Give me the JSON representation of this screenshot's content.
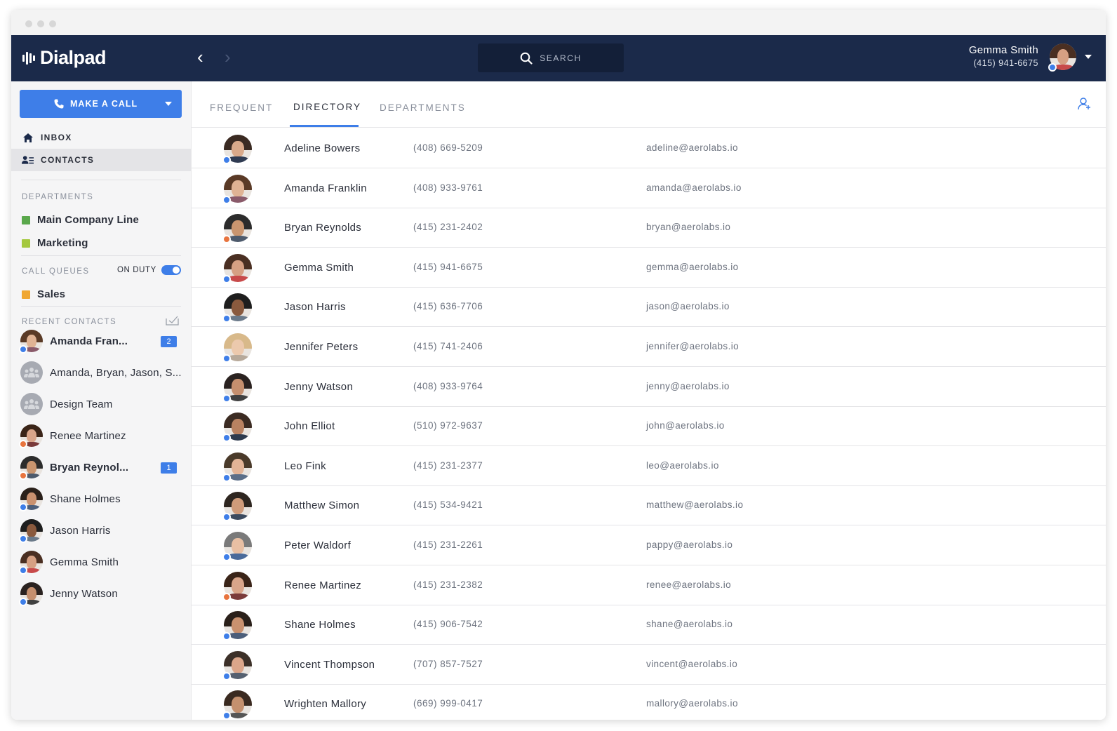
{
  "app": {
    "logo_text": "Dialpad"
  },
  "header": {
    "search_label": "SEARCH",
    "user_name": "Gemma Smith",
    "user_phone": "(415) 941-6675",
    "user_status": "online"
  },
  "sidebar": {
    "call_button_label": "MAKE A CALL",
    "nav": [
      {
        "label": "INBOX",
        "icon": "home-icon",
        "active": false
      },
      {
        "label": "CONTACTS",
        "icon": "contacts-icon",
        "active": true
      }
    ],
    "departments_label": "DEPARTMENTS",
    "departments": [
      {
        "label": "Main Company Line",
        "color": "#5aa84c"
      },
      {
        "label": "Marketing",
        "color": "#a4c83e"
      }
    ],
    "call_queues_label": "CALL QUEUES",
    "on_duty_label": "ON DUTY",
    "on_duty": true,
    "call_queues": [
      {
        "label": "Sales",
        "color": "#f0a732"
      }
    ],
    "recent_label": "RECENT CONTACTS",
    "recent": [
      {
        "name": "Amanda Fran...",
        "bold": true,
        "badge": "2",
        "status": "online",
        "type": "person"
      },
      {
        "name": "Amanda, Bryan, Jason, S...",
        "bold": false,
        "badge": "",
        "status": "",
        "type": "group"
      },
      {
        "name": "Design Team",
        "bold": false,
        "badge": "",
        "status": "",
        "type": "group"
      },
      {
        "name": "Renee Martinez",
        "bold": false,
        "badge": "",
        "status": "dnd",
        "type": "person"
      },
      {
        "name": "Bryan Reynol...",
        "bold": true,
        "badge": "1",
        "status": "dnd",
        "type": "person"
      },
      {
        "name": "Shane Holmes",
        "bold": false,
        "badge": "",
        "status": "online",
        "type": "person"
      },
      {
        "name": "Jason Harris",
        "bold": false,
        "badge": "",
        "status": "online",
        "type": "person"
      },
      {
        "name": "Gemma Smith",
        "bold": false,
        "badge": "",
        "status": "online",
        "type": "person"
      },
      {
        "name": "Jenny Watson",
        "bold": false,
        "badge": "",
        "status": "online",
        "type": "person"
      }
    ]
  },
  "main": {
    "tabs": [
      {
        "label": "FREQUENT",
        "active": false
      },
      {
        "label": "DIRECTORY",
        "active": true
      },
      {
        "label": "DEPARTMENTS",
        "active": false
      }
    ],
    "contacts": [
      {
        "name": "Adeline Bowers",
        "phone": "(408) 669-5209",
        "email": "adeline@aerolabs.io",
        "status": "online"
      },
      {
        "name": "Amanda Franklin",
        "phone": "(408) 933-9761",
        "email": "amanda@aerolabs.io",
        "status": "online"
      },
      {
        "name": "Bryan Reynolds",
        "phone": "(415) 231-2402",
        "email": "bryan@aerolabs.io",
        "status": "dnd"
      },
      {
        "name": "Gemma Smith",
        "phone": "(415) 941-6675",
        "email": "gemma@aerolabs.io",
        "status": "online"
      },
      {
        "name": "Jason Harris",
        "phone": "(415) 636-7706",
        "email": "jason@aerolabs.io",
        "status": "online"
      },
      {
        "name": "Jennifer Peters",
        "phone": "(415) 741-2406",
        "email": "jennifer@aerolabs.io",
        "status": "online"
      },
      {
        "name": "Jenny Watson",
        "phone": "(408) 933-9764",
        "email": "jenny@aerolabs.io",
        "status": "online"
      },
      {
        "name": "John Elliot",
        "phone": "(510) 972-9637",
        "email": "john@aerolabs.io",
        "status": "online"
      },
      {
        "name": "Leo Fink",
        "phone": "(415) 231-2377",
        "email": "leo@aerolabs.io",
        "status": "online"
      },
      {
        "name": "Matthew Simon",
        "phone": "(415) 534-9421",
        "email": "matthew@aerolabs.io",
        "status": "online"
      },
      {
        "name": "Peter Waldorf",
        "phone": "(415) 231-2261",
        "email": "pappy@aerolabs.io",
        "status": "online"
      },
      {
        "name": "Renee Martinez",
        "phone": "(415) 231-2382",
        "email": "renee@aerolabs.io",
        "status": "dnd"
      },
      {
        "name": "Shane Holmes",
        "phone": "(415) 906-7542",
        "email": "shane@aerolabs.io",
        "status": "online"
      },
      {
        "name": "Vincent Thompson",
        "phone": "(707) 857-7527",
        "email": "vincent@aerolabs.io",
        "status": "online"
      },
      {
        "name": "Wrighten Mallory",
        "phone": "(669) 999-0417",
        "email": "mallory@aerolabs.io",
        "status": "online"
      }
    ]
  },
  "colors": {
    "navy": "#1b2a4a",
    "accent": "#3e7ee8",
    "dnd": "#e8743e"
  }
}
